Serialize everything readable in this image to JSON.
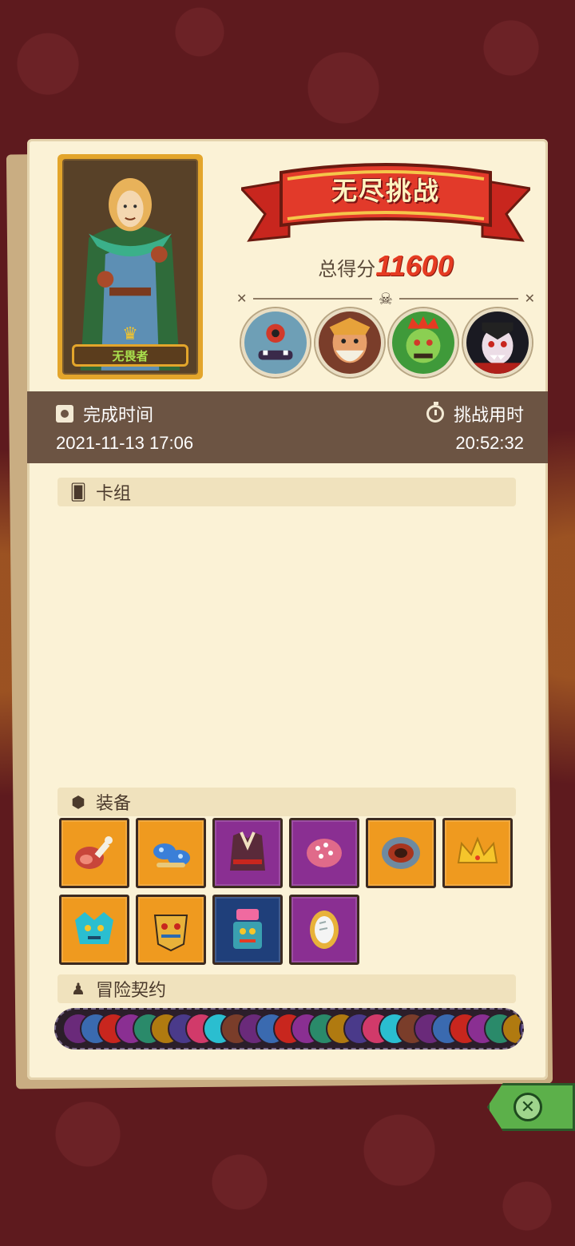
{
  "hero": {
    "name": "无畏者"
  },
  "challenge": {
    "title": "无尽挑战",
    "score_label": "总得分",
    "score_value": "11600"
  },
  "bosses": [
    {
      "icon": "cyclops-ogre-boss"
    },
    {
      "icon": "bearded-warrior-boss"
    },
    {
      "icon": "goblin-king-boss"
    },
    {
      "icon": "vampire-boss"
    }
  ],
  "info": {
    "finish_label": "完成时间",
    "finish_value": "2021-11-13 17:06",
    "time_label": "挑战用时",
    "time_value": "20:52:32"
  },
  "sections": {
    "deck": "卡组",
    "equipment": "装备",
    "contract": "冒险契约"
  },
  "equipment": [
    {
      "icon": "meat-leg-icon",
      "rarity": "orange"
    },
    {
      "icon": "blue-mushroom-icon",
      "rarity": "orange"
    },
    {
      "icon": "purple-armor-icon",
      "rarity": "purple"
    },
    {
      "icon": "spotted-egg-icon",
      "rarity": "purple"
    },
    {
      "icon": "fire-ring-icon",
      "rarity": "orange"
    },
    {
      "icon": "gold-crown-icon",
      "rarity": "orange"
    },
    {
      "icon": "blue-dragon-mask-icon",
      "rarity": "orange"
    },
    {
      "icon": "tribal-mask-icon",
      "rarity": "orange"
    },
    {
      "icon": "pink-totem-icon",
      "rarity": "blue"
    },
    {
      "icon": "magic-mirror-icon",
      "rarity": "purple"
    }
  ],
  "colors": {
    "background": "#5e1a1e",
    "paper": "#fbf2d6",
    "info_bar": "#6c5443",
    "score": "#e53b22",
    "rarity_orange": "#ef9a1f",
    "rarity_purple": "#8a2f92",
    "rarity_blue": "#1f3f7a",
    "close_button": "#5cb04a"
  }
}
